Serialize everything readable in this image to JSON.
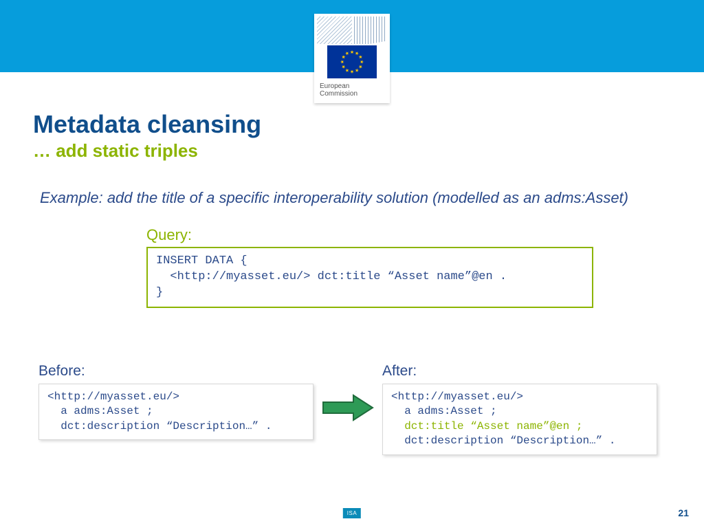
{
  "header": {
    "logo_line1": "European",
    "logo_line2": "Commission"
  },
  "title": "Metadata cleansing",
  "subtitle": "… add static triples",
  "example_text": "Example: add the title of a specific interoperability solution (modelled as an adms:Asset)",
  "query": {
    "label": "Query:",
    "code": "INSERT DATA {\n  <http://myasset.eu/> dct:title “Asset name”@en .\n}"
  },
  "before": {
    "label": "Before:",
    "code": "<http://myasset.eu/>\n  a adms:Asset ;\n  dct:description “Description…” ."
  },
  "after": {
    "label": "After:",
    "line1": "<http://myasset.eu/>",
    "line2": "  a adms:Asset ;",
    "line3_hl": "  dct:title “Asset name”@en ;",
    "line4": "  dct:description “Description…” ."
  },
  "footer": {
    "isa": "ISA",
    "page": "21"
  }
}
